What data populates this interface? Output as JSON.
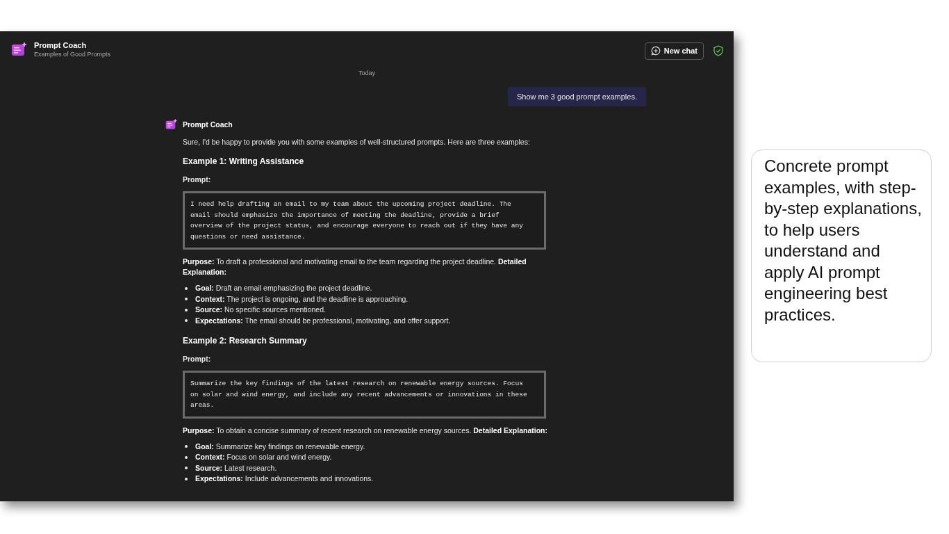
{
  "header": {
    "title": "Prompt Coach",
    "subtitle": "Examples of Good Prompts",
    "new_chat": "New chat"
  },
  "date_divider": "Today",
  "messages": [
    {
      "kind": "user",
      "text": "Show me 3 good prompt examples."
    },
    {
      "kind": "bot",
      "sender": "Prompt Coach",
      "intro": "Sure, I'd be happy to provide you with some examples of well-structured prompts. Here are three examples:",
      "examples": [
        {
          "heading": "Example 1: Writing Assistance",
          "prompt_label": "Prompt:",
          "prompt_lines": [
            "I need help drafting an email to my team about the upcoming project deadline. The",
            "email should emphasize the importance of meeting the deadline, provide a brief",
            "overview of the project status, and encourage everyone to reach out if they have any",
            "questions or need assistance."
          ],
          "purpose": "**Purpose:** To draft a professional and motivating email to the team regarding the project deadline. **Detailed Explanation:**",
          "points": [
            "**Goal:** Draft an email emphasizing the project deadline.",
            "**Context:** The project is ongoing, and the deadline is approaching.",
            "**Source:** No specific sources mentioned.",
            "**Expectations:** The email should be professional, motivating, and offer support."
          ]
        },
        {
          "heading": "Example 2: Research Summary",
          "prompt_label": "Prompt:",
          "prompt_lines": [
            "Summarize the key findings of the latest research on renewable energy sources. Focus",
            "on solar and wind energy, and include any recent advancements or innovations in these",
            "areas."
          ],
          "purpose": "**Purpose:** To obtain a concise summary of recent research on renewable energy sources. **Detailed Explanation:**",
          "points": [
            "**Goal:** Summarize key findings on renewable energy.",
            "**Context:** Focus on solar and wind energy.",
            "**Source:** Latest research.",
            "**Expectations:** Include advancements and innovations."
          ]
        }
      ]
    }
  ],
  "callout": "Concrete prompt examples, with step-by-step explanations, to help users understand and apply AI prompt engineering best practices."
}
